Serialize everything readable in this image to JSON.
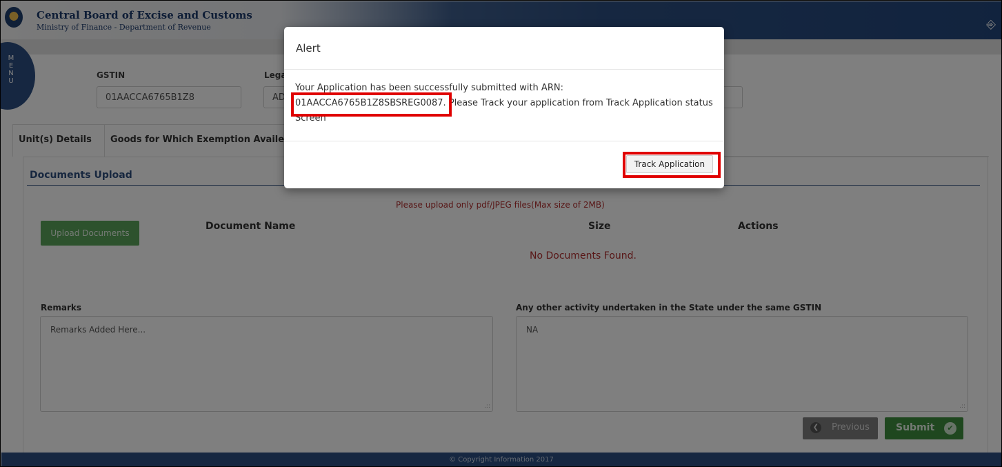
{
  "header": {
    "org_name": "Central Board of Excise and Customs",
    "org_sub": "Ministry of Finance - Department of Revenue",
    "logout_icon": "logout-icon"
  },
  "menu": {
    "letters": [
      "M",
      "E",
      "N",
      "U"
    ]
  },
  "info": {
    "gstin_label": "GSTIN",
    "gstin_value": "01AACCA6765B1Z8",
    "legal_label": "Lega",
    "legal_value": "AD"
  },
  "tabs": [
    {
      "label": "Unit(s) Details"
    },
    {
      "label": "Goods for Which Exemption Availed"
    }
  ],
  "documents": {
    "title": "Documents Upload",
    "note": "Please upload only pdf/JPEG files(Max size of 2MB)",
    "upload_button": "Upload Documents",
    "columns": [
      "Document Name",
      "Size",
      "Actions"
    ],
    "empty_text": "No Documents Found."
  },
  "remarks": {
    "label": "Remarks",
    "placeholder": "Remarks Added Here..."
  },
  "activity": {
    "label": "Any other activity undertaken in the State under the same GSTIN",
    "value": "NA"
  },
  "buttons": {
    "previous": "Previous",
    "submit": "Submit"
  },
  "footer": {
    "text": "© Copyright Information 2017"
  },
  "modal": {
    "title": "Alert",
    "message_prefix": "Your Application has been successfully submitted with ARN:",
    "arn": "01AACCA6765B1Z8SBSREG0087.",
    "message_suffix": " Please Track your application from Track Application status Screen",
    "track_button": "Track Application"
  },
  "colors": {
    "brand_blue": "#2d4f82",
    "highlight_red": "#e00000",
    "success_green": "#3f8f3f"
  }
}
